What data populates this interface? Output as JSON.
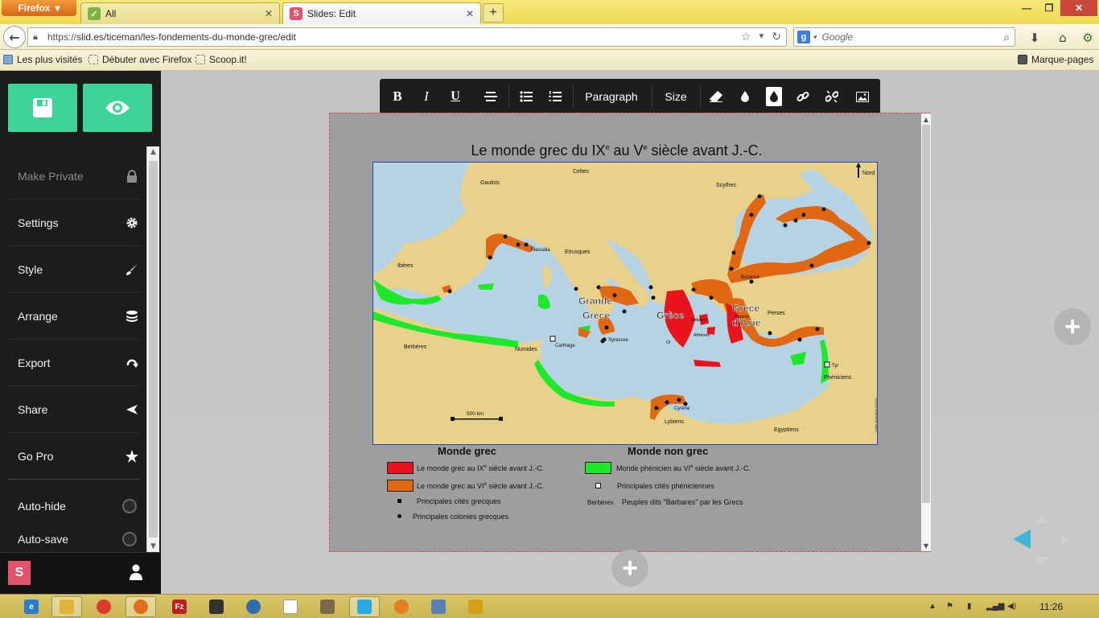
{
  "browser": {
    "menu_button": "Firefox",
    "tabs": [
      {
        "title": "All",
        "active": false
      },
      {
        "title": "Slides: Edit",
        "active": true
      }
    ],
    "url": "https://slid.es/ticeman/les-fondements-du-monde-grec/edit",
    "url_protocol": "https://",
    "url_rest": "slid.es/ticeman/les-fondements-du-monde-grec/edit",
    "search_placeholder": "Google",
    "bookmarks": [
      "Les plus visités",
      "Débuter avec Firefox",
      "Scoop.it!"
    ],
    "bookmarks_menu": "Marque-pages"
  },
  "sidebar": {
    "items": [
      {
        "label": "Make Private",
        "icon": "lock-icon",
        "disabled": true
      },
      {
        "label": "Settings",
        "icon": "gear-icon"
      },
      {
        "label": "Style",
        "icon": "brush-icon"
      },
      {
        "label": "Arrange",
        "icon": "layers-icon"
      },
      {
        "label": "Export",
        "icon": "export-icon"
      },
      {
        "label": "Share",
        "icon": "share-icon"
      },
      {
        "label": "Go Pro",
        "icon": "star-icon"
      }
    ],
    "toggles": [
      {
        "label": "Auto-hide",
        "on": false
      },
      {
        "label": "Auto-save",
        "on": false
      }
    ],
    "logo_letter": "S"
  },
  "toolbar": {
    "bold": "B",
    "italic": "I",
    "underline": "U",
    "paragraph": "Paragraph",
    "size": "Size"
  },
  "slide": {
    "title_pre": "Le monde grec du IX",
    "title_sup1": "e",
    "title_mid": " au V",
    "title_sup2": "e",
    "title_post": " siècle avant J.-C.",
    "map_labels": {
      "north": "Nord",
      "celtes": "Celtes",
      "gaulois": "Gaulois",
      "scythes": "Scythes",
      "iberes": "Ibères",
      "massalia": "Massalia",
      "etrusques": "Etrusques",
      "byzance": "Byzance",
      "grande": "Grande",
      "grece_it": "Grèce",
      "grece": "Grèce",
      "grece_asie1": "Grèce",
      "grece_asie2": "d'Asie",
      "phocee": "Phocée",
      "perses": "Perses",
      "delphes": "Delphes",
      "athenes": "Athènes",
      "olympie": "Ol",
      "syracuse": "Syracuse",
      "carthage": "Carthage",
      "berberes": "Berbères",
      "numides": "Numides",
      "tyr": "Tyr",
      "pheniciens": "Phéniciens",
      "cyrene": "Cyrène",
      "lybiens": "Lybiens",
      "egyptiens": "Egyptiens",
      "scale": "500 km",
      "credit": "Cyber-historiens M2012"
    },
    "legend": {
      "heading_grec": "Monde grec",
      "heading_non_grec": "Monde non grec",
      "ix_pre": "Le monde grec au IX",
      "ix_sup": "e",
      "ix_post": " siècle avant J.-C.",
      "vi_pre": "Le monde grec au VI",
      "vi_sup": "e",
      "vi_post": " siècle avant J.-C.",
      "cites_grecques": "Principales cités grecques",
      "colonies_grecques": "Principales colonies grecques",
      "phen_pre": "Monde phénicien au VI",
      "phen_sup": "e",
      "phen_post": "  siècle avant J.-C.",
      "cites_pheniciennes": "Principales cités phéniciennes",
      "berberes_key": "Berbères",
      "barbares": "Peuples dits \"Barbares\" par les Grecs"
    }
  },
  "taskbar": {
    "clock": "11:26"
  },
  "colors": {
    "accent_green": "#3fd497",
    "sidebar_bg": "#1c1c1c",
    "sea": "#b5d3e3",
    "land": "#e8d28b",
    "ix_red": "#e8141b",
    "vi_orange": "#e06812",
    "phoenician_green": "#1ee82a"
  }
}
